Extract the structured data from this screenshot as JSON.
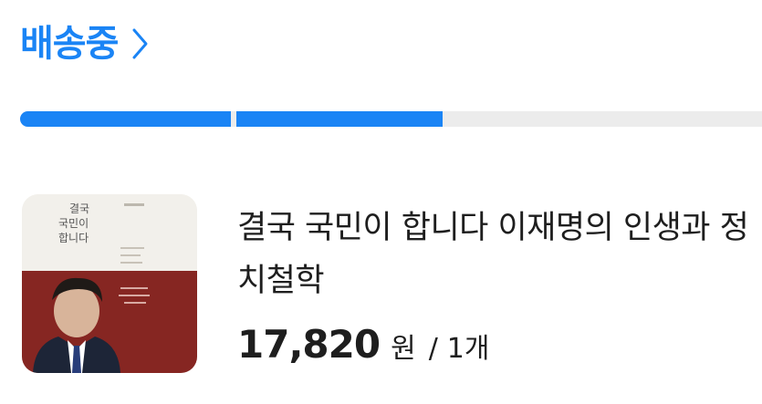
{
  "status": {
    "title": "배송중",
    "chevron_icon": "chevron-right-icon",
    "color": "#1a84f5"
  },
  "progress": {
    "segments_total": 4,
    "segments_complete": 2,
    "complete_color": "#1a84f5",
    "track_color": "#ececec"
  },
  "item": {
    "title": "결국 국민이 합니다 이재명의 인생과 정치철학",
    "price": "17,820",
    "currency": "원",
    "separator": "/",
    "quantity": "1개",
    "cover": {
      "title_lines": [
        "결국",
        "국민이",
        "합니다"
      ]
    }
  }
}
